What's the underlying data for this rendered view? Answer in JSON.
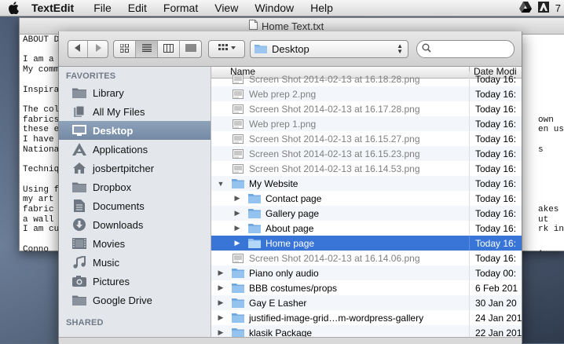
{
  "menubar": {
    "app": "TextEdit",
    "items": [
      "File",
      "Edit",
      "Format",
      "View",
      "Window",
      "Help"
    ],
    "right_text": "7"
  },
  "window": {
    "title": "Home Text.txt"
  },
  "document": {
    "lines": [
      "ABOUT D",
      "",
      "I am a",
      "My comm",
      "",
      "Inspira",
      "",
      "The col",
      "fabrics",
      "these e",
      "I have",
      "Nationa",
      "",
      "Techniq",
      "",
      "Using f",
      "my art",
      "fabric",
      "a wall",
      "I am cu",
      "",
      "Conno"
    ],
    "right_fragments": [
      {
        "text": "own",
        "line": 9
      },
      {
        "text": "en use",
        "line": 10
      },
      {
        "text": "s",
        "line": 12
      },
      {
        "text": "akes",
        "line": 18
      },
      {
        "text": "ut",
        "line": 19
      },
      {
        "text": "rk in",
        "line": 20
      },
      {
        "text": ".",
        "line": 22
      }
    ]
  },
  "toolbar": {
    "back_icon": "chevron-left",
    "forward_icon": "chevron-right",
    "view_modes": [
      "icon-view",
      "list-view",
      "column-view",
      "coverflow-view"
    ],
    "arrange_icon": "arrange-grid",
    "location": "Desktop"
  },
  "sidebar": {
    "favorites_heading": "FAVORITES",
    "items": [
      {
        "label": "Library",
        "icon": "folder-icon",
        "selected": false
      },
      {
        "label": "All My Files",
        "icon": "all-files-icon",
        "selected": false
      },
      {
        "label": "Desktop",
        "icon": "desktop-icon",
        "selected": true
      },
      {
        "label": "Applications",
        "icon": "applications-icon",
        "selected": false
      },
      {
        "label": "josbertpitcher",
        "icon": "home-icon",
        "selected": false
      },
      {
        "label": "Dropbox",
        "icon": "folder-icon",
        "selected": false
      },
      {
        "label": "Documents",
        "icon": "documents-icon",
        "selected": false
      },
      {
        "label": "Downloads",
        "icon": "downloads-icon",
        "selected": false
      },
      {
        "label": "Movies",
        "icon": "movies-icon",
        "selected": false
      },
      {
        "label": "Music",
        "icon": "music-icon",
        "selected": false
      },
      {
        "label": "Pictures",
        "icon": "pictures-icon",
        "selected": false
      },
      {
        "label": "Google Drive",
        "icon": "folder-icon",
        "selected": false
      }
    ],
    "shared_heading": "SHARED"
  },
  "list": {
    "name_header": "Name",
    "date_header": "Date Modi",
    "rows": [
      {
        "name": "Screen Shot 2014-02-13 at 16.18.28.png",
        "date": "Today 16:",
        "type": "file",
        "level": 0,
        "dim": true,
        "selected": false,
        "expanded": false
      },
      {
        "name": "Web prep 2.png",
        "date": "Today 16:",
        "type": "file",
        "level": 0,
        "dim": true,
        "selected": false,
        "expanded": false
      },
      {
        "name": "Screen Shot 2014-02-13 at 16.17.28.png",
        "date": "Today 16:",
        "type": "file",
        "level": 0,
        "dim": true,
        "selected": false,
        "expanded": false
      },
      {
        "name": "Web prep 1.png",
        "date": "Today 16:",
        "type": "file",
        "level": 0,
        "dim": true,
        "selected": false,
        "expanded": false
      },
      {
        "name": "Screen Shot 2014-02-13 at 16.15.27.png",
        "date": "Today 16:",
        "type": "file",
        "level": 0,
        "dim": true,
        "selected": false,
        "expanded": false
      },
      {
        "name": "Screen Shot 2014-02-13 at 16.15.23.png",
        "date": "Today 16:",
        "type": "file",
        "level": 0,
        "dim": true,
        "selected": false,
        "expanded": false
      },
      {
        "name": "Screen Shot 2014-02-13 at 16.14.53.png",
        "date": "Today 16:",
        "type": "file",
        "level": 0,
        "dim": true,
        "selected": false,
        "expanded": false
      },
      {
        "name": "My Website",
        "date": "Today 16:",
        "type": "folder",
        "level": 0,
        "dim": false,
        "selected": false,
        "expanded": true
      },
      {
        "name": "Contact page",
        "date": "Today 16:",
        "type": "folder",
        "level": 1,
        "dim": false,
        "selected": false,
        "expanded": false
      },
      {
        "name": "Gallery page",
        "date": "Today 16:",
        "type": "folder",
        "level": 1,
        "dim": false,
        "selected": false,
        "expanded": false
      },
      {
        "name": "About page",
        "date": "Today 16:",
        "type": "folder",
        "level": 1,
        "dim": false,
        "selected": false,
        "expanded": false
      },
      {
        "name": "Home page",
        "date": "Today 16:",
        "type": "folder",
        "level": 1,
        "dim": false,
        "selected": true,
        "expanded": false
      },
      {
        "name": "Screen Shot 2014-02-13 at 16.14.06.png",
        "date": "Today 16:",
        "type": "file",
        "level": 0,
        "dim": true,
        "selected": false,
        "expanded": false
      },
      {
        "name": "Piano only audio",
        "date": "Today 00:",
        "type": "folder",
        "level": 0,
        "dim": false,
        "selected": false,
        "expanded": false
      },
      {
        "name": "BBB costumes/props",
        "date": "6 Feb 201",
        "type": "folder",
        "level": 0,
        "dim": false,
        "selected": false,
        "expanded": false
      },
      {
        "name": "Gay E Lasher",
        "date": "30 Jan 20",
        "type": "folder",
        "level": 0,
        "dim": false,
        "selected": false,
        "expanded": false
      },
      {
        "name": "justified-image-grid…m-wordpress-gallery",
        "date": "24 Jan 201",
        "type": "folder",
        "level": 0,
        "dim": false,
        "selected": false,
        "expanded": false
      },
      {
        "name": "klasik Package",
        "date": "22 Jan 201",
        "type": "folder",
        "level": 0,
        "dim": false,
        "selected": false,
        "expanded": false
      }
    ]
  },
  "colors": {
    "selection": "#3875d7",
    "sidebar_selection": "#7d91ad",
    "folder": "#7fb2e5"
  }
}
